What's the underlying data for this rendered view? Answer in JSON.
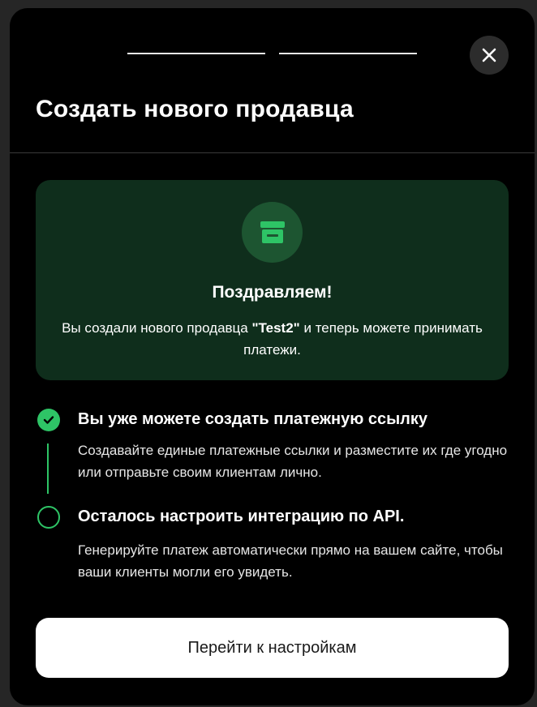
{
  "modal": {
    "title": "Создать нового продавца",
    "close_icon": "close-icon",
    "progress_steps": 2
  },
  "success_card": {
    "icon": "store-icon",
    "heading": "Поздравляем!",
    "message_before": "Вы создали нового продавца ",
    "seller_name": "\"Test2\"",
    "message_after": " и теперь можете принимать платежи."
  },
  "steps": [
    {
      "status": "done",
      "title": "Вы уже можете создать платежную ссылку",
      "description": "Создавайте единые платежные ссылки и разместите их где угодно или отправьте своим клиентам лично."
    },
    {
      "status": "pending",
      "title": "Осталось настроить интеграцию по API.",
      "description": "Генерируйте платеж автоматически прямо на вашем сайте, чтобы ваши клиенты могли его увидеть."
    }
  ],
  "primary_button": {
    "label": "Перейти к настройкам"
  },
  "colors": {
    "accent_green": "#2ec466",
    "card_bg": "#0f2e1c",
    "modal_bg": "#000000"
  }
}
